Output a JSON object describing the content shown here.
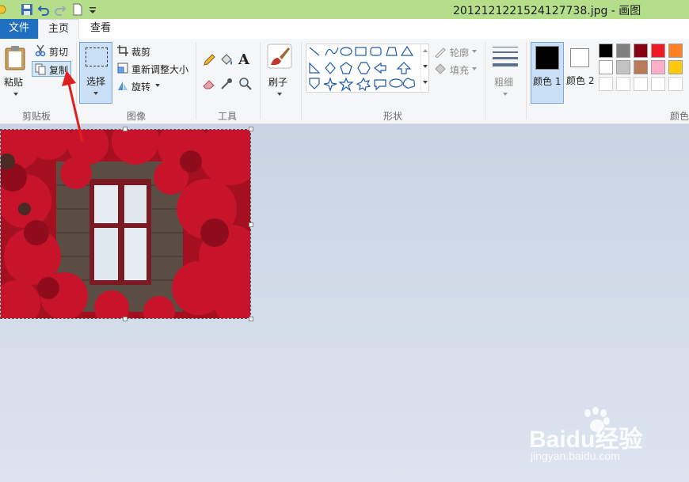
{
  "window": {
    "title": "2012121221524127738.jpg - 画图"
  },
  "tabs": {
    "file": "文件",
    "home": "主页",
    "view": "查看"
  },
  "clipboard": {
    "paste": "粘贴",
    "cut": "剪切",
    "copy": "复制",
    "group": "剪贴板"
  },
  "image": {
    "select": "选择",
    "crop": "裁剪",
    "resize": "重新调整大小",
    "rotate": "旋转",
    "group": "图像"
  },
  "tools": {
    "group": "工具"
  },
  "brushes": {
    "label": "刷子"
  },
  "shapes": {
    "outline": "轮廓",
    "fill": "填充",
    "group": "形状"
  },
  "size": {
    "label": "粗细"
  },
  "colors": {
    "color1": "颜色 1",
    "color2": "颜色 2",
    "group": "颜色",
    "color1_value": "#000000",
    "color2_value": "#ffffff",
    "palette_row1": [
      "#000000",
      "#7f7f7f",
      "#880015",
      "#ed1c24",
      "#ff7f27"
    ],
    "palette_row2": [
      "#ffffff",
      "#c3c3c3",
      "#b97a57",
      "#ffaec9",
      "#ffc90e"
    ]
  },
  "watermark": {
    "brand": "Baidu经验",
    "url": "jingyan.baidu.com"
  }
}
